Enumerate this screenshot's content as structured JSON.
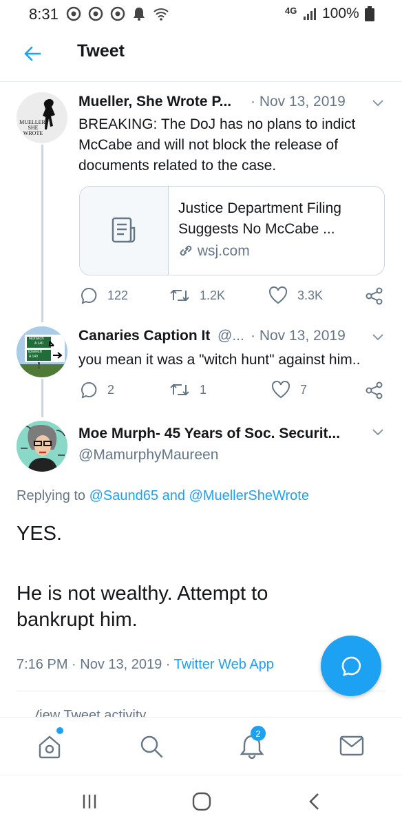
{
  "status_bar": {
    "time": "8:31",
    "network": "4G",
    "battery": "100%"
  },
  "header": {
    "title": "Tweet"
  },
  "tweets": [
    {
      "name": "Mueller, She Wrote P...",
      "date": "Nov 13, 2019",
      "avatar_text": "MUELLER, SHE WROTE",
      "text": "BREAKING: The DoJ has no plans to indict McCabe and will not block the release of documents related to the case.",
      "card": {
        "title": "Justice Department Filing Suggests No McCabe ...",
        "domain": "wsj.com"
      },
      "replies": "122",
      "retweets": "1.2K",
      "likes": "3.3K"
    },
    {
      "name": "Canaries Caption It",
      "handle": "@...",
      "date": "Nov 13, 2019",
      "avatar_sign": {
        "top": "Norwich",
        "top_road": "A 140",
        "bottom": "Ipswich",
        "bottom_road": "A 140"
      },
      "text": "you mean it was a \"witch hunt\" against him..",
      "replies": "2",
      "retweets": "1",
      "likes": "7"
    }
  ],
  "main_tweet": {
    "name": "Moe Murph- 45 Years of Soc. Securit...",
    "handle": "@MamurphyMaureen",
    "replying_prefix": "Replying to",
    "replying_user1": "@Saund65",
    "replying_and": "and",
    "replying_user2": "@MuellerSheWrote",
    "line1": "YES.",
    "line2": "He is not wealthy. Attempt to bankrupt him.",
    "time": "7:16 PM",
    "date": "Nov 13, 2019",
    "source": "Twitter Web App",
    "activity": "View Tweet activity"
  },
  "tabbar": {
    "notifications_badge": "2"
  },
  "colors": {
    "accent": "#1da1f2",
    "muted": "#657786",
    "text": "#14171a",
    "border": "#ccd6dd"
  }
}
